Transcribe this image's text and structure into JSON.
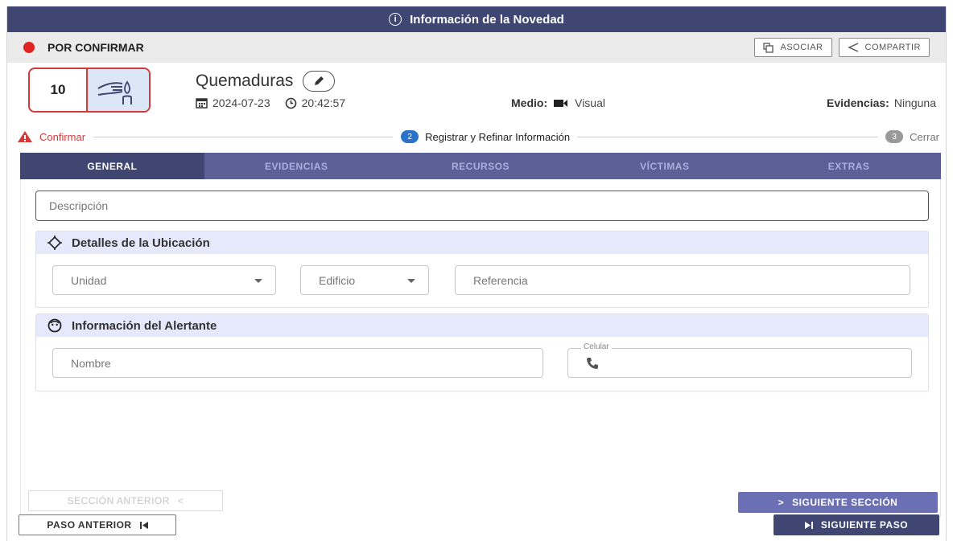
{
  "window": {
    "title": "Información de la Novedad",
    "info_icon": "info-icon"
  },
  "status": {
    "label": "POR CONFIRMAR",
    "color": "#e02424"
  },
  "actions": {
    "asociar": "ASOCIAR",
    "compartir": "COMPARTIR"
  },
  "incident": {
    "code": "10",
    "icon": "hand-burn-icon",
    "title": "Quemaduras",
    "date": "2024-07-23",
    "time": "20:42:57",
    "medio_label": "Medio:",
    "medio_value": "Visual",
    "evidencias_label": "Evidencias:",
    "evidencias_value": "Ninguna"
  },
  "stepper": {
    "steps": [
      {
        "label": "Confirmar",
        "marker": "warning-icon"
      },
      {
        "number": "2",
        "label": "Registrar y Refinar Información"
      },
      {
        "number": "3",
        "label": "Cerrar"
      }
    ]
  },
  "tabs": [
    {
      "label": "GENERAL",
      "active": true
    },
    {
      "label": "EVIDENCIAS"
    },
    {
      "label": "RECURSOS"
    },
    {
      "label": "VÍCTIMAS"
    },
    {
      "label": "EXTRAS"
    }
  ],
  "form": {
    "descripcion_placeholder": "Descripción",
    "ubicacion": {
      "title": "Detalles de la Ubicación",
      "unidad": "Unidad",
      "edificio": "Edificio",
      "referencia": "Referencia"
    },
    "alertante": {
      "title": "Información del Alertante",
      "nombre": "Nombre",
      "celular_label": "Celular"
    }
  },
  "nav": {
    "prev_section": "SECCIÓN ANTERIOR",
    "next_section": "SIGUIENTE SECCIÓN",
    "prev_step": "PASO ANTERIOR",
    "next_step": "SIGUIENTE PASO"
  },
  "colors": {
    "primary": "#3e4671",
    "tab_bar": "#5b6197",
    "accent_button": "#6a70b3",
    "alert_red": "#d33a3a",
    "section_header": "#e6e9fb"
  }
}
